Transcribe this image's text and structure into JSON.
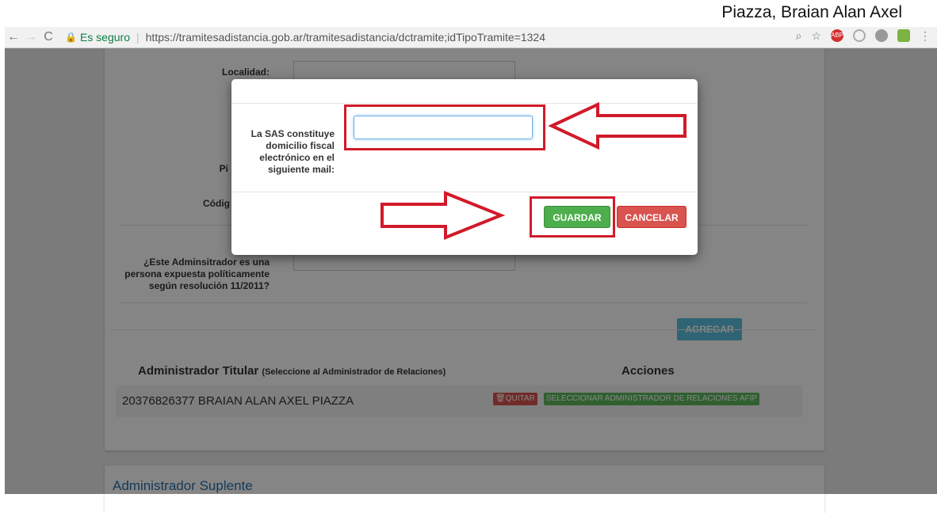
{
  "caption": "Piazza, Braian Alan Axel",
  "browser": {
    "secure_label": "Es seguro",
    "url": "https://tramitesadistancia.gob.ar/tramitesadistancia/dctramite;idTipoTramite=1324",
    "back_icon": "←",
    "forward_icon": "→",
    "reload_icon": "C",
    "ext_abp_label": "ABP"
  },
  "form": {
    "localidad_label": "Localidad:",
    "piso_label_partial": "Pi",
    "codigo_label_partial": "Códig",
    "pep_question": "¿Este Adminsitrador es una persona expuesta políticamente según resolución 11/2011?",
    "add_button": "AGREGAR"
  },
  "table": {
    "header_main": "Administrador Titular",
    "header_sub": "(Seleccione al Administrador de Relaciones)",
    "header_actions": "Acciones",
    "rows": [
      {
        "name": "20376826377 BRAIAN ALAN AXEL PIAZZA",
        "remove_label": "QUITAR",
        "select_label": "SELECCIONAR ADMINISTRADOR DE RELACIONES AFIP"
      }
    ]
  },
  "section2_title": "Administrador Suplente",
  "modal": {
    "field_label": "La SAS constituye domicilio fiscal electrónico en el siguiente mail:",
    "field_value": "",
    "save_label": "GUARDAR",
    "cancel_label": "CANCELAR"
  },
  "colors": {
    "annotation_red": "#d11a2a",
    "save_green": "#4cae4c",
    "cancel_red": "#d9534f",
    "link_blue": "#2a6fa8"
  }
}
